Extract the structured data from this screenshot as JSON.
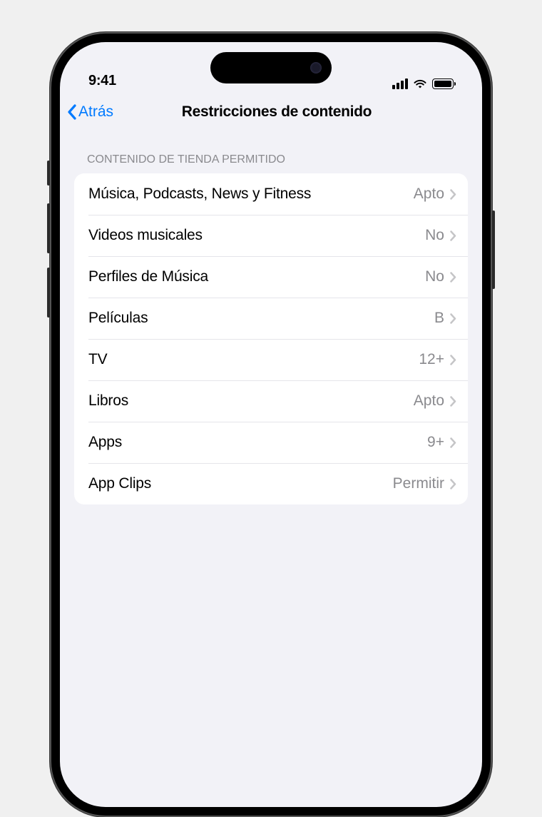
{
  "status": {
    "time": "9:41"
  },
  "nav": {
    "back_label": "Atrás",
    "title": "Restricciones de contenido"
  },
  "section": {
    "header": "CONTENIDO DE TIENDA PERMITIDO",
    "rows": [
      {
        "label": "Música, Podcasts, News y Fitness",
        "value": "Apto"
      },
      {
        "label": "Videos musicales",
        "value": "No"
      },
      {
        "label": "Perfiles de Música",
        "value": "No"
      },
      {
        "label": "Películas",
        "value": "B"
      },
      {
        "label": "TV",
        "value": "12+"
      },
      {
        "label": "Libros",
        "value": "Apto"
      },
      {
        "label": "Apps",
        "value": "9+"
      },
      {
        "label": "App Clips",
        "value": "Permitir"
      }
    ]
  }
}
